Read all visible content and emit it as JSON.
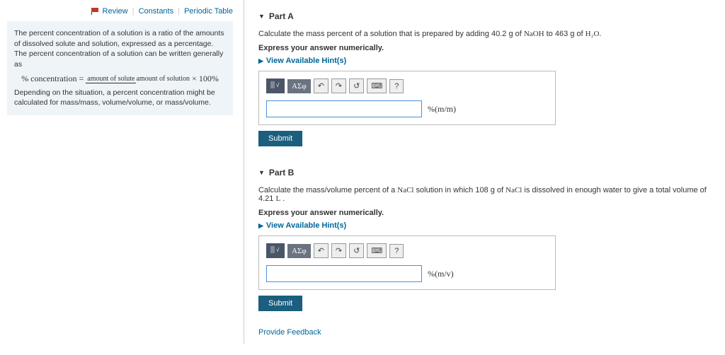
{
  "links": {
    "review": "Review",
    "constants": "Constants",
    "periodic": "Periodic Table"
  },
  "info": {
    "p1": "The percent concentration of a solution is a ratio of the amounts of dissolved solute and solution, expressed as a percentage. The percent concentration of a solution can be written generally as",
    "formula_left": "% concentration =",
    "formula_num": "amount of solute",
    "formula_den": "amount of solution",
    "formula_right": "× 100%",
    "p2": "Depending on the situation, a percent concentration might be calculated for mass/mass, volume/volume, or mass/volume."
  },
  "partA": {
    "title": "Part A",
    "q_pre": "Calculate the mass percent of a solution that is prepared by adding 40.2 g of ",
    "chem1": "NaOH",
    "q_mid": " to 463 g of ",
    "chem2": "H₂O",
    "q_post": ".",
    "express": "Express your answer numerically.",
    "hints": "View Available Hint(s)",
    "unit": "%(m/m)",
    "submit": "Submit"
  },
  "partB": {
    "title": "Part B",
    "q_pre": "Calculate the mass/volume percent of a ",
    "chem1": "NaCl",
    "q_mid1": " solution in which 108 g of ",
    "chem2": "NaCl",
    "q_mid2": " is dissolved in enough water to give a total volume of 4.21 ",
    "unitL": "L",
    "q_post": " .",
    "express": "Express your answer numerically.",
    "hints": "View Available Hint(s)",
    "unit": "%(m/v)",
    "submit": "Submit"
  },
  "toolbar": {
    "help": "?"
  },
  "feedback": "Provide Feedback"
}
